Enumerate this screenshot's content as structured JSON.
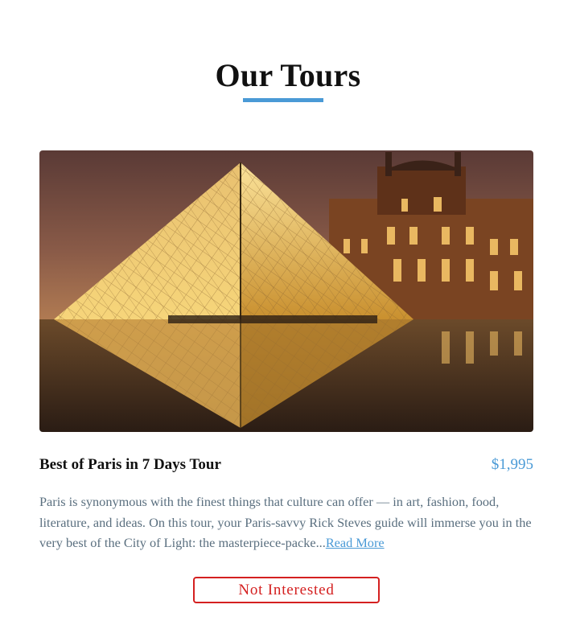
{
  "header": {
    "title": "Our Tours"
  },
  "tour": {
    "name": "Best of Paris in 7 Days Tour",
    "price": "$1,995",
    "description": "Paris is synonymous with the finest things that culture can offer — in art, fashion, food, literature, and ideas. On this tour, your Paris-savvy Rick Steves guide will immerse you in the very best of the City of Light: the masterpiece-packe...",
    "read_more": "Read More",
    "image_icon": "louvre-pyramid-photo"
  },
  "actions": {
    "not_interested": "Not Interested"
  },
  "colors": {
    "accent": "#4a9ad6",
    "danger": "#d42020",
    "body_text": "#5a6f7f"
  }
}
